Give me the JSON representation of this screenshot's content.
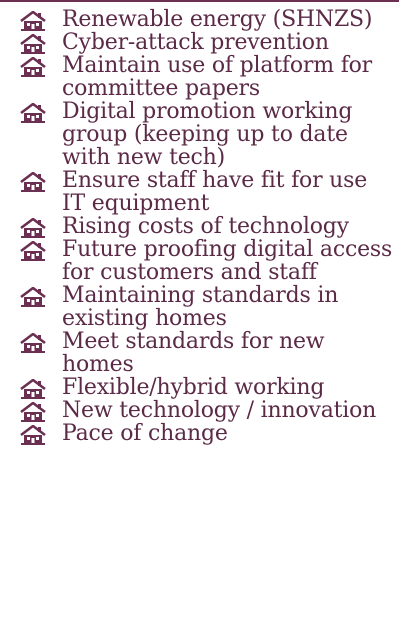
{
  "colors": {
    "text": "#5b2a47",
    "rule": "#6b2f52",
    "icon": "#6b2f52"
  },
  "bullet_icon": "house-icon",
  "items": [
    {
      "text": "Renewable energy (SHNZS)"
    },
    {
      "text": "Cyber-attack prevention"
    },
    {
      "text": "Maintain use of platform for committee papers"
    },
    {
      "text": "Digital promotion working group (keeping up to date with new tech)"
    },
    {
      "text": "Ensure staff have fit for use IT equipment"
    },
    {
      "text": "Rising costs of technology"
    },
    {
      "text": "Future proofing digital access for customers and staff"
    },
    {
      "text": "Maintaining standards in existing homes"
    },
    {
      "text": "Meet standards for new homes"
    },
    {
      "text": "Flexible/hybrid working"
    },
    {
      "text": "New technology / innovation"
    },
    {
      "text": "Pace of change"
    }
  ]
}
